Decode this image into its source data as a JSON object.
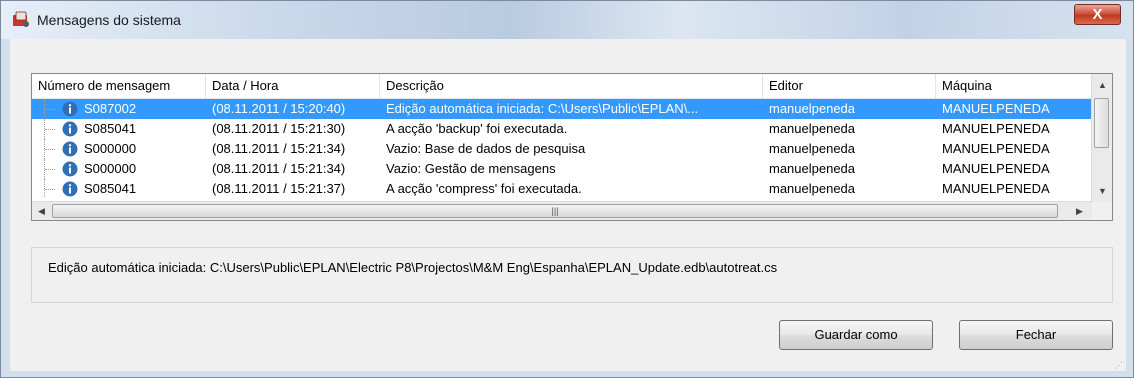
{
  "window": {
    "title": "Mensagens do sistema",
    "close_label": "X"
  },
  "table": {
    "columns": [
      "Número de mensagem",
      "Data / Hora",
      "Descrição",
      "Editor",
      "Máquina"
    ],
    "rows": [
      {
        "code": "S087002",
        "datetime": "(08.11.2011 / 15:20:40)",
        "description": "Edição automática iniciada: C:\\Users\\Public\\EPLAN\\...",
        "editor": "manuelpeneda",
        "machine": "MANUELPENEDA",
        "selected": true
      },
      {
        "code": "S085041",
        "datetime": "(08.11.2011 / 15:21:30)",
        "description": "A acção 'backup' foi executada.",
        "editor": "manuelpeneda",
        "machine": "MANUELPENEDA",
        "selected": false
      },
      {
        "code": "S000000",
        "datetime": "(08.11.2011 / 15:21:34)",
        "description": "Vazio: Base de dados de pesquisa",
        "editor": "manuelpeneda",
        "machine": "MANUELPENEDA",
        "selected": false
      },
      {
        "code": "S000000",
        "datetime": "(08.11.2011 / 15:21:34)",
        "description": "Vazio: Gestão de mensagens",
        "editor": "manuelpeneda",
        "machine": "MANUELPENEDA",
        "selected": false
      },
      {
        "code": "S085041",
        "datetime": "(08.11.2011 / 15:21:37)",
        "description": "A acção 'compress' foi executada.",
        "editor": "manuelpeneda",
        "machine": "MANUELPENEDA",
        "selected": false
      }
    ]
  },
  "details": {
    "text": "Edição automática iniciada: C:\\Users\\Public\\EPLAN\\Electric P8\\Projectos\\M&M Eng\\Espanha\\EPLAN_Update.edb\\autotreat.cs"
  },
  "buttons": {
    "save_as": "Guardar como",
    "close": "Fechar"
  },
  "icons": {
    "row_icon": "info-icon",
    "app_icon": "eplan-app-icon"
  },
  "colors": {
    "selection": "#3399ff",
    "close_button": "#c0391f",
    "info_icon": "#2f6fb8"
  }
}
